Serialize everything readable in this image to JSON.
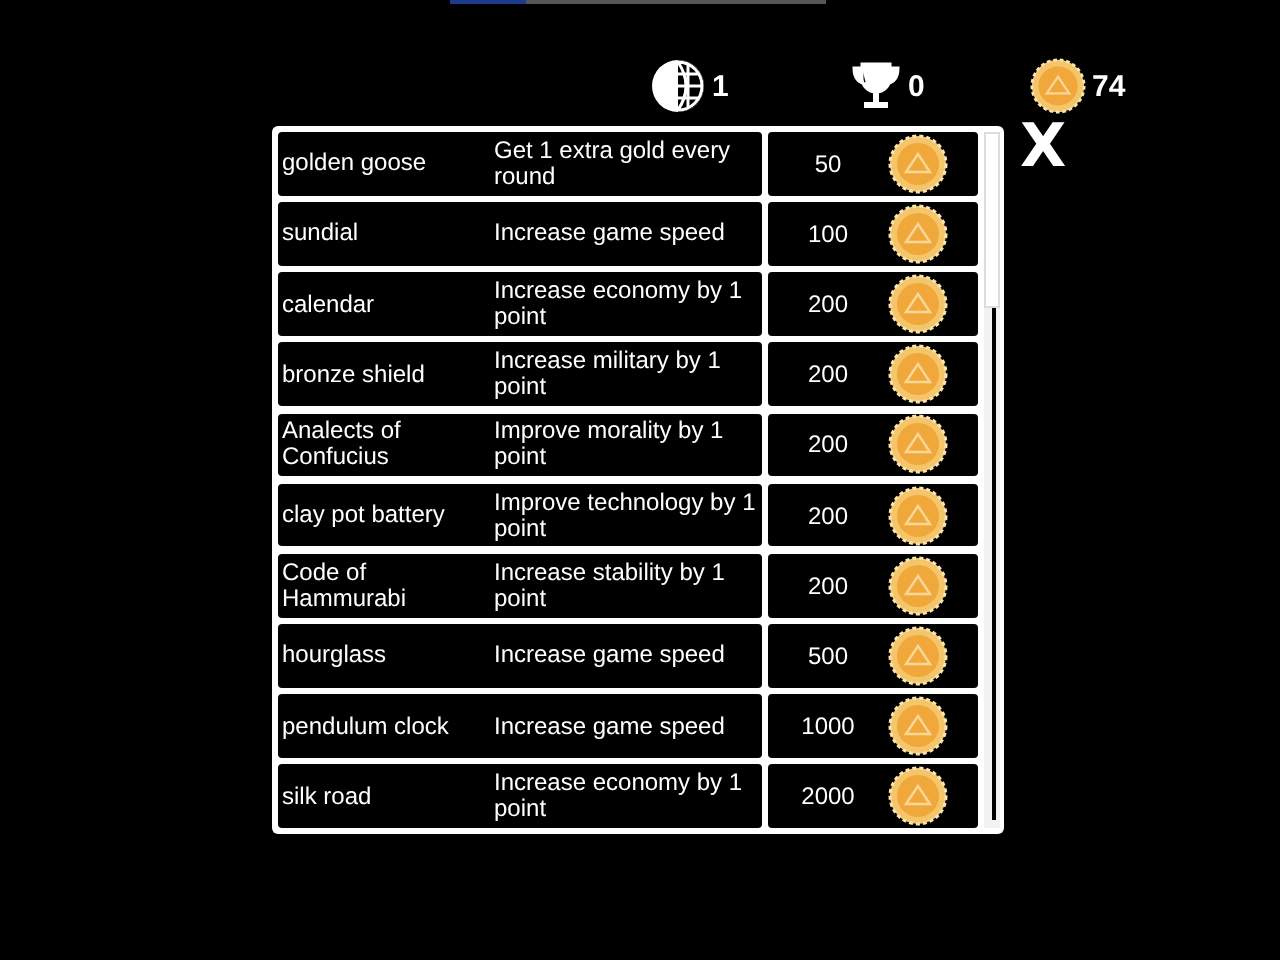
{
  "stats": [
    {
      "kind": "globe",
      "value": "1"
    },
    {
      "kind": "trophy",
      "value": "0"
    },
    {
      "kind": "coin",
      "value": "74"
    }
  ],
  "close": {
    "label": "X"
  },
  "items": [
    {
      "name": "golden goose",
      "effect": "Get 1 extra gold every round",
      "price": "50"
    },
    {
      "name": "sundial",
      "effect": "Increase game speed",
      "price": "100"
    },
    {
      "name": "calendar",
      "effect": "Increase economy by 1 point",
      "price": "200"
    },
    {
      "name": "bronze shield",
      "effect": "Increase military by 1 point",
      "price": "200"
    },
    {
      "name": "Analects of Confucius",
      "effect": "Improve morality by 1 point",
      "price": "200"
    },
    {
      "name": "clay pot battery",
      "effect": "Improve technology by 1 point",
      "price": "200"
    },
    {
      "name": "Code of Hammurabi",
      "effect": "Increase stability by 1 point",
      "price": "200"
    },
    {
      "name": "hourglass",
      "effect": "Increase game speed",
      "price": "500"
    },
    {
      "name": "pendulum clock",
      "effect": "Increase game speed",
      "price": "1000"
    },
    {
      "name": "silk road",
      "effect": "Increase economy by 1 point",
      "price": "2000"
    }
  ]
}
